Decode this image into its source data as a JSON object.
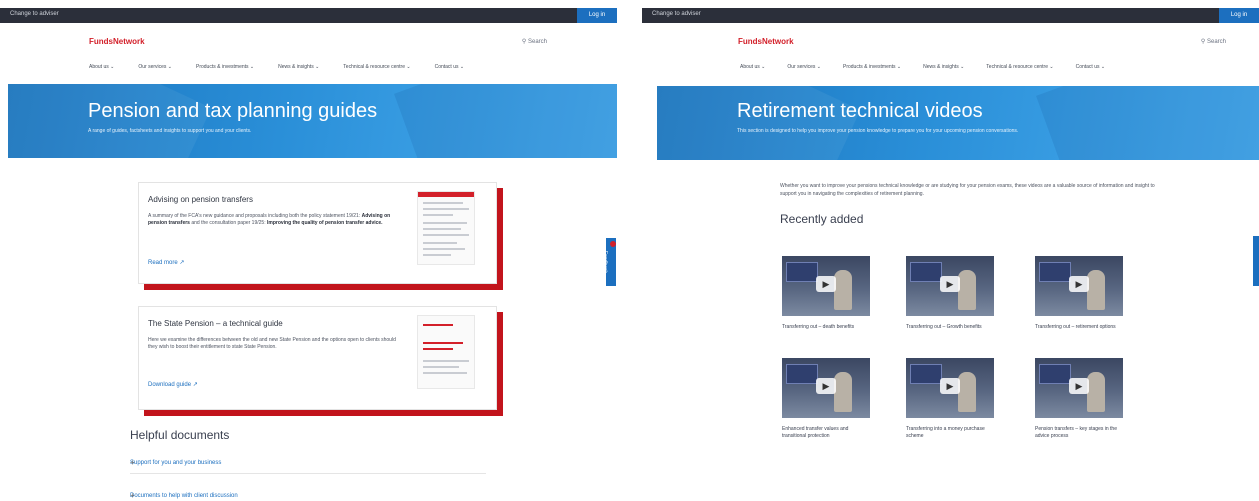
{
  "common": {
    "topbar_selector": "Change to adviser",
    "topbar_login": "Log in",
    "logo": "FundsNetwork",
    "search": "Search",
    "nav": [
      "About us",
      "Our services",
      "Products & investments",
      "News & insights",
      "Technical & resource centre",
      "Contact us"
    ]
  },
  "left": {
    "hero_title": "Pension and tax planning guides",
    "hero_subtitle": "A range of guides, factsheets and insights to support you and your clients.",
    "side_tab": "Feedback",
    "cards": [
      {
        "title": "Advising on pension transfers",
        "desc_pre": "A summary of the FCA's new guidance and proposals including both the policy statement 19/21: ",
        "desc_bold1": "Advising on pension transfers",
        "desc_mid": " and the consultation paper 19/25: ",
        "desc_bold2": "Improving the quality of pension transfer advice.",
        "link": "Read more"
      },
      {
        "title": "The State Pension – a technical guide",
        "desc": "Here we examine the differences between the old and new State Pension and the options open to clients should they wish to boost their entitlement to state State Pension.",
        "link": "Download guide"
      }
    ],
    "helpful_title": "Helpful documents",
    "accordion": [
      {
        "label": "Support for you and your business",
        "chev": "+"
      },
      {
        "label": "Documents to help with client discussion",
        "chev": "+"
      }
    ]
  },
  "right": {
    "hero_title": "Retirement technical videos",
    "hero_subtitle": "This section is designed to help you improve your pension knowledge to prepare you for your upcoming pension conversations.",
    "intro": "Whether you want to improve your pensions technical knowledge or are studying for your pension exams, these videos are a valuable source of information and insight to support you in navigating the complexities of retirement planning.",
    "recent_title": "Recently added",
    "videos": [
      {
        "caption": "Transferring out – death benefits"
      },
      {
        "caption": "Transferring out – Growth benefits"
      },
      {
        "caption": "Transferring out – retirement options"
      },
      {
        "caption": "Enhanced transfer values and transitional protection"
      },
      {
        "caption": "Transferring into a money purchase scheme"
      },
      {
        "caption": "Pension transfers – key stages in the advice process"
      }
    ],
    "play_icon": "▶"
  }
}
